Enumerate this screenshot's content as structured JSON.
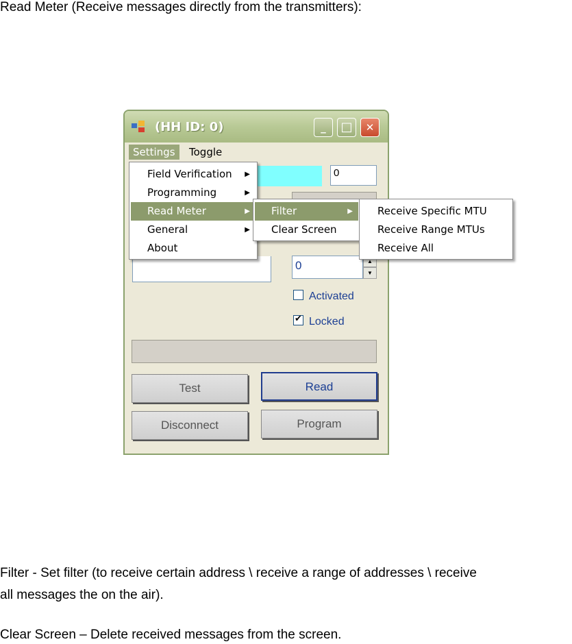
{
  "heading": "Read Meter (Receive messages directly from the transmitters):",
  "paragraphs": {
    "filter_line1": "Filter - Set filter (to receive certain address \\ receive a range of addresses \\ receive",
    "filter_line2": "all messages the on the air).",
    "clear_line": "Clear Screen – Delete received messages from the screen."
  },
  "window": {
    "title": "(HH ID: 0)",
    "menubar": {
      "settings": "Settings",
      "toggle": "Toggle"
    },
    "fields": {
      "id_value": "0",
      "spin_value": "0"
    },
    "checkboxes": {
      "activated": "Activated",
      "locked": "Locked"
    },
    "buttons": {
      "test": "Test",
      "read": "Read",
      "disconnect": "Disconnect",
      "program": "Program"
    }
  },
  "menus": {
    "settings_items": [
      "Field Verification",
      "Programming",
      "Read Meter",
      "General",
      "About"
    ],
    "read_meter_items": [
      "Filter",
      "Clear Screen"
    ],
    "filter_items": [
      "Receive Specific MTU",
      "Receive Range MTUs",
      "Receive All"
    ]
  },
  "colors": {
    "selection": "#8c9b6c",
    "cyan_field": "#80ffff",
    "title_bar": "#b8c995"
  },
  "icons": {
    "arrow": "▶",
    "tick": "✔",
    "up": "▲",
    "down": "▼",
    "min": "_",
    "max": "□",
    "close": "✕"
  }
}
